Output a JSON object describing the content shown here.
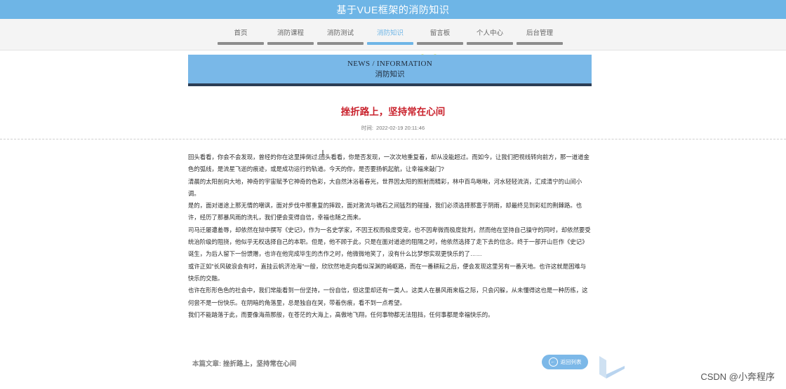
{
  "app": {
    "title": "基于VUE框架的消防知识"
  },
  "nav": {
    "items": [
      {
        "label": "首页",
        "active": false
      },
      {
        "label": "消防课程",
        "active": false
      },
      {
        "label": "消防测试",
        "active": false
      },
      {
        "label": "消防知识",
        "active": true
      },
      {
        "label": "留言板",
        "active": false
      },
      {
        "label": "个人中心",
        "active": false
      },
      {
        "label": "后台管理",
        "active": false
      }
    ],
    "accent_color": "#6eb5e6",
    "inactive_bar_color": "#8c8c8c"
  },
  "banner": {
    "en_title": "NEWS / INFORMATION",
    "cn_title": "消防知识",
    "background": "#79b8e8",
    "border_color": "#2c3e55"
  },
  "article": {
    "title": "挫折路上，坚持常在心间",
    "time_label": "时间:",
    "time_value": "2022-02-19 20:11:46",
    "title_color": "#c9212c",
    "paragraphs": [
      "回头看看，你会不会发现，曾经的你在这里摔倒过;回头看看，你是否发现，一次次地重复着，却从没能超过。而如今，让我们把视线转向前方，那一道道金色的弧线，是流星飞逝的痕迹，或是成功运行的轨道。今天的你，是否要扬帆起航，让幸福来敲门?",
      "清晨的太阳剖向大地，神奇的宇宙赋予它神奇的色彩，大自然沐浴着春光，世界因太阳的照射而精彩，林中百鸟啾啾，河水轻轻流淌，汇成清宁的山间小调。",
      "是的，面对道途上那无情的嘲讽，面对步伐中那重复的摔跤，面对激流与礁石之间猛烈的碰撞，我们必须选择那富于阴雨，却最终见到彩虹的荆棘路。也许，经历了那暴风雨的洗礼，我们便会变得自信，幸福也随之而来。",
      "司马迁屡遭羞辱，却依然在狱中撰写《史记》，作为一名史学家，不因王权而极度受宠，也不因卑微而极度批判，然而他在坚持自己操守的同时，却依然要受统治阶级的阻挠，他似乎无权选择自己的本职。但是，他不顾于此，只是在面对道途的阻隔之时，他依然选择了走下去的信念。终于一部开山巨作《史记》诞生，为后人留下一份馈赠，也许在他完成毕生的杰作之时，他微微地笑了，没有什么比梦想实现更快乐的了……",
      "或许正如\"长风破浪会有时，直挂云帆济沧海\"一般，欣欣然地走向看似深渊的崎岖路，而在一番耕耘之后，便会发现这里另有一番天地。也许这就是困难与快乐的交融。",
      "也许在形形色色的社会中，我们常能看到一份坚持，一份自信，但这里却还有一类人。这类人在暴风雨来临之际，只会闪躲，从未懂得这也是一种历练，这何尝不是一份快乐。在阴暗的角落里，总是独自在哭，带着伤痕，看不到一点希望。",
      "我们不能踏落于此，而要像海燕那般，在苍茫的大海上，高傲地飞翔，任何事物都无法阻挡，任何事都是幸福快乐的。"
    ]
  },
  "footer": {
    "label": "本篇文章:",
    "article_title": "挫折路上，坚持常在心间",
    "back_button": "返回列表",
    "back_button_color": "#7cb8e8"
  },
  "watermark": "CSDN @小奔程序"
}
